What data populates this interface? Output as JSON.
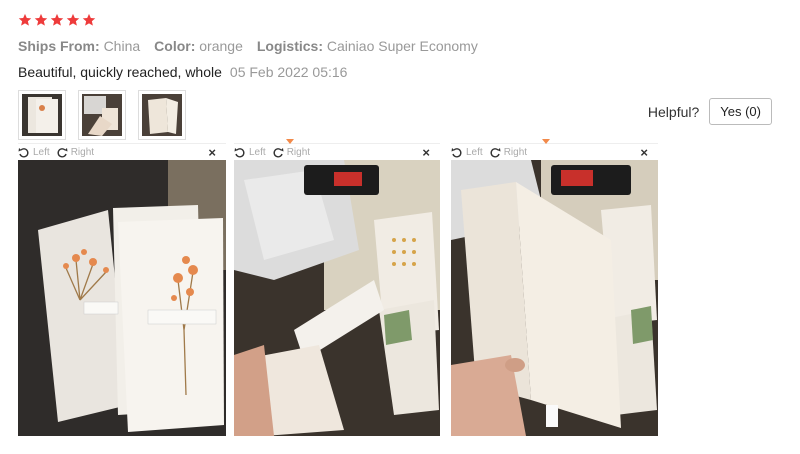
{
  "rating": {
    "stars": 5,
    "star_color": "#ee3b3b"
  },
  "meta": [
    {
      "label": "Ships From:",
      "value": "China"
    },
    {
      "label": "Color:",
      "value": "orange"
    },
    {
      "label": "Logistics:",
      "value": "Cainiao Super Economy"
    }
  ],
  "review": {
    "text": "Beautiful, quickly reached, whole",
    "date": "05 Feb 2022 05:16"
  },
  "helpful": {
    "label": "Helpful?",
    "yes_button": "Yes (0)"
  },
  "viewer": {
    "left_label": "Left",
    "right_label": "Right",
    "close_symbol": "×",
    "left_icon": "rotate-left-icon",
    "right_icon": "rotate-right-icon"
  }
}
